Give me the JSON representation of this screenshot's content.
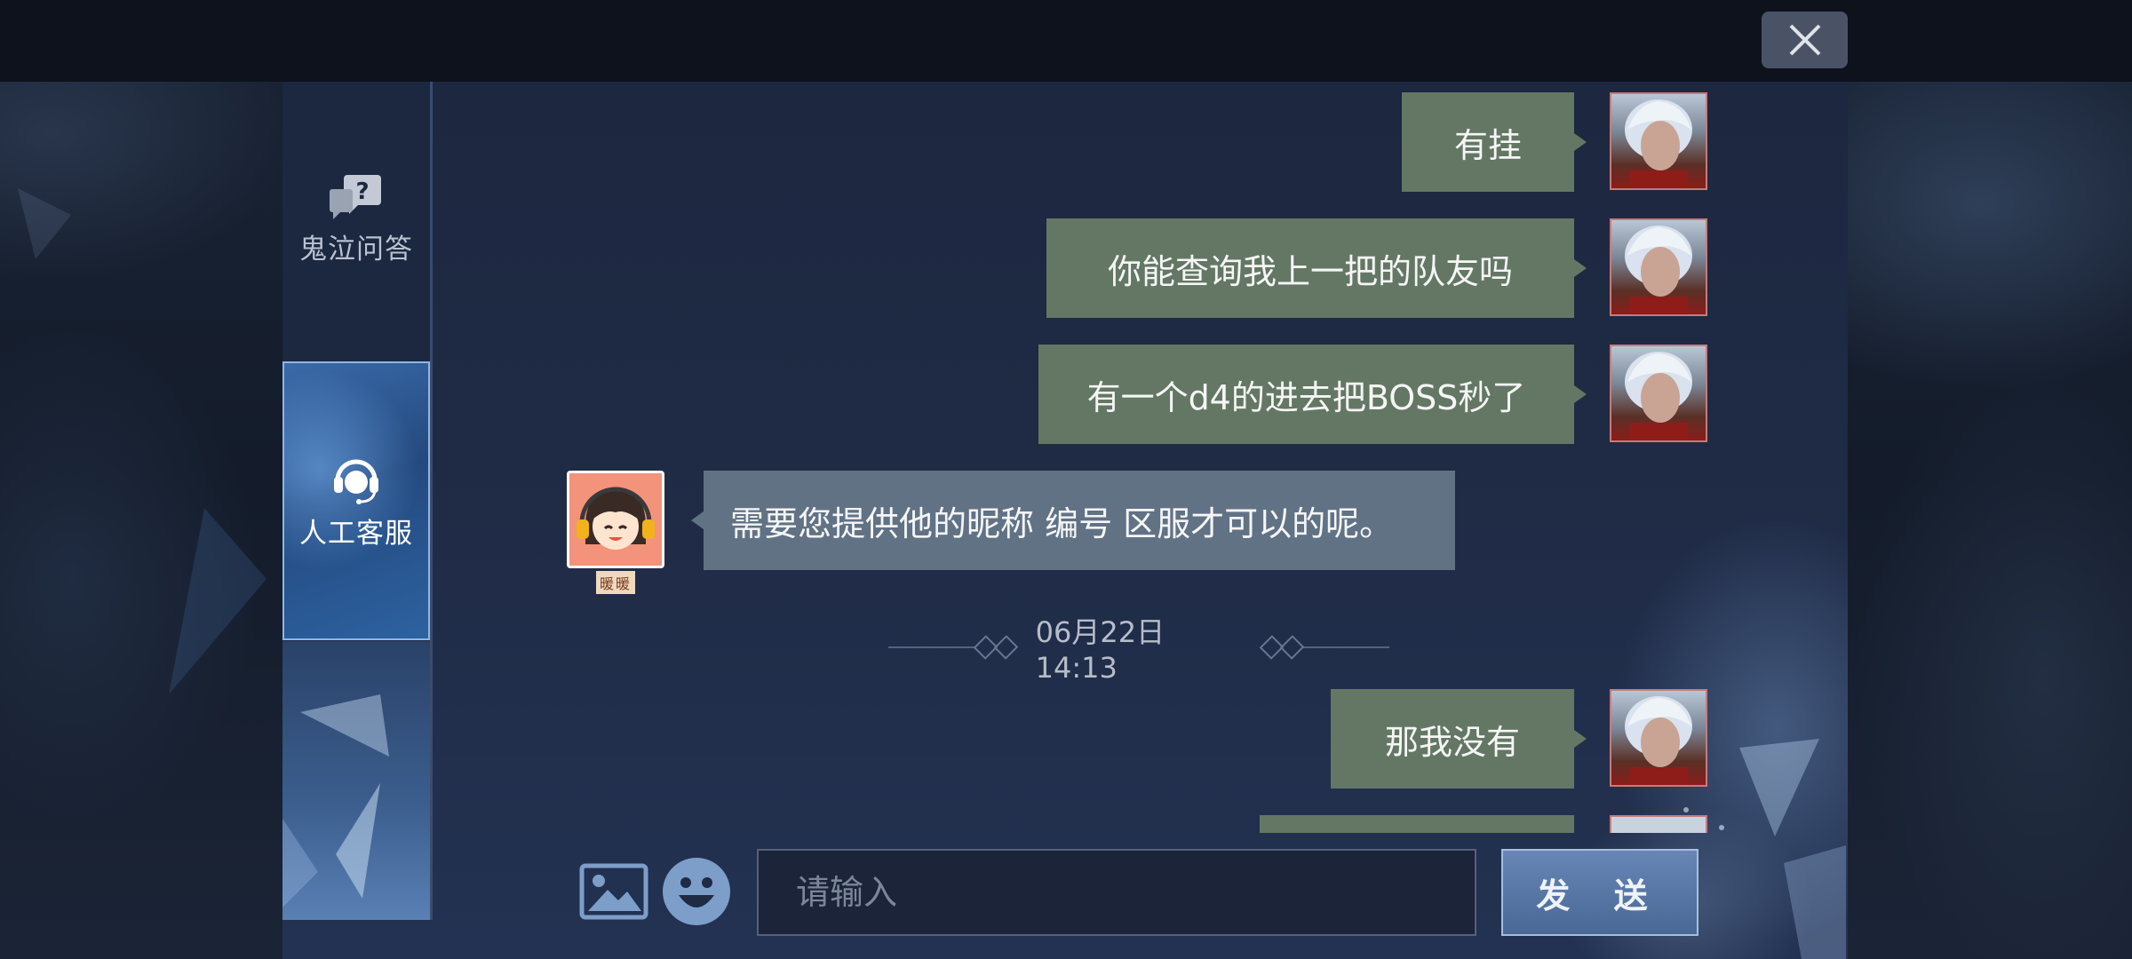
{
  "window": {
    "close_label": "×"
  },
  "sidebar": {
    "items": [
      {
        "label": "鬼泣问答",
        "icon": "question-chat-icon",
        "active": false
      },
      {
        "label": "人工客服",
        "icon": "headset-icon",
        "active": true
      }
    ]
  },
  "messages": [
    {
      "from": "user",
      "text": "有挂"
    },
    {
      "from": "user",
      "text": "你能查询我上一把的队友吗"
    },
    {
      "from": "user",
      "text": "有一个d4的进去把BOSS秒了"
    },
    {
      "from": "agent",
      "text": "需要您提供他的昵称 编号  区服才可以的呢。",
      "agent_name": "暖暖"
    },
    {
      "from": "timestamp",
      "text": "06月22日 14:13"
    },
    {
      "from": "user",
      "text": "那我没有"
    }
  ],
  "input": {
    "placeholder": "请输入",
    "value": ""
  },
  "send_label": "发 送",
  "colors": {
    "user_bubble": "#647765",
    "agent_bubble": "#627285",
    "send_button": "#5a79a8"
  }
}
